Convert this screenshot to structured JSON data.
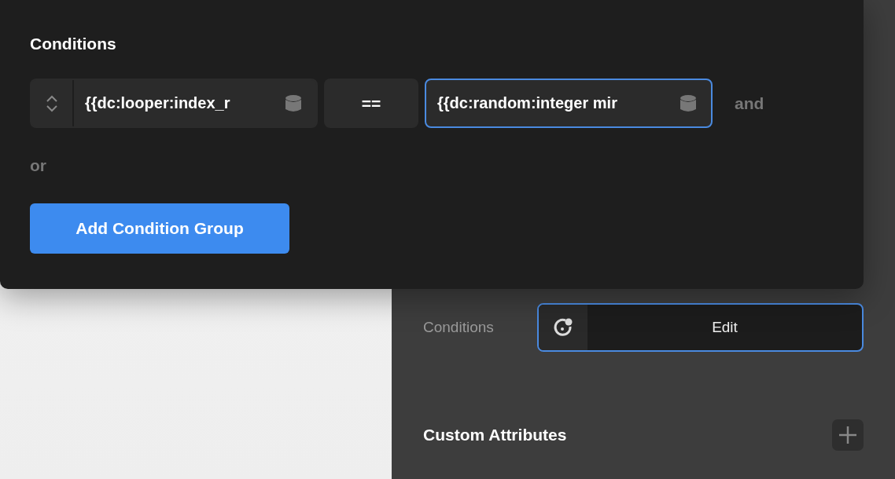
{
  "popup": {
    "title": "Conditions",
    "rows": [
      {
        "left": "{{dc:looper:index_r",
        "left_focused": false,
        "operator": "==",
        "right": "{{dc:random:integer mir",
        "right_focused": true,
        "joiner": "and"
      }
    ],
    "or_label": "or",
    "add_button": "Add Condition Group"
  },
  "panel": {
    "conditions_label": "Conditions",
    "edit_button": "Edit",
    "edit_focused": true,
    "section_title": "Custom Attributes"
  }
}
